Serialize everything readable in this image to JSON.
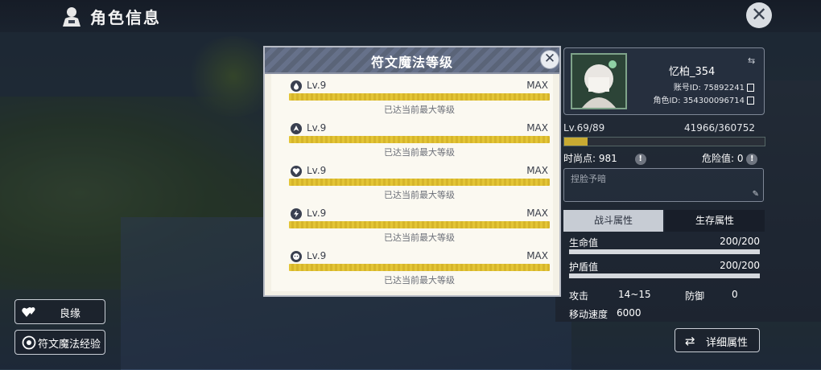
{
  "header": {
    "title": "角色信息"
  },
  "left_buttons": {
    "affinity": "良缘",
    "rune_exp": "符文魔法经验"
  },
  "modal": {
    "title": "符文魔法等级",
    "runes": [
      {
        "icon": "droplet-rune-icon",
        "level": "Lv.9",
        "max": "MAX",
        "progress": 1.0,
        "note": "已达当前最大等级"
      },
      {
        "icon": "flame-rune-icon",
        "level": "Lv.9",
        "max": "MAX",
        "progress": 1.0,
        "note": "已达当前最大等级"
      },
      {
        "icon": "heart-rune-icon",
        "level": "Lv.9",
        "max": "MAX",
        "progress": 1.0,
        "note": "已达当前最大等级"
      },
      {
        "icon": "lightning-rune-icon",
        "level": "Lv.9",
        "max": "MAX",
        "progress": 1.0,
        "note": "已达当前最大等级"
      },
      {
        "icon": "face-rune-icon",
        "level": "Lv.9",
        "max": "MAX",
        "progress": 1.0,
        "note": "已达当前最大等级"
      }
    ]
  },
  "profile": {
    "name": "忆柏_354",
    "account_id": "账号ID: 75892241",
    "role_id": "角色ID: 354300096714",
    "level": "Lv.69/89",
    "exp": "41966/360752",
    "exp_progress": 0.116,
    "time_points": "时尚点: 981",
    "danger": "危险值: 0",
    "note_placeholder": "捏脸予暗"
  },
  "tabs": {
    "combat": "战斗属性",
    "survival": "生存属性"
  },
  "attributes": {
    "hp_label": "生命值",
    "hp_value": "200/200",
    "shield_label": "护盾值",
    "shield_value": "200/200",
    "attack_label": "攻击",
    "attack_value": "14~15",
    "defense_label": "防御",
    "defense_value": "0",
    "speed_label": "移动速度",
    "speed_value": "6000"
  },
  "detail_button": "详细属性",
  "colors": {
    "bar_gold": "#e3c536",
    "modal_header": "#5a6478",
    "tab_active": "#c7ccd4"
  }
}
